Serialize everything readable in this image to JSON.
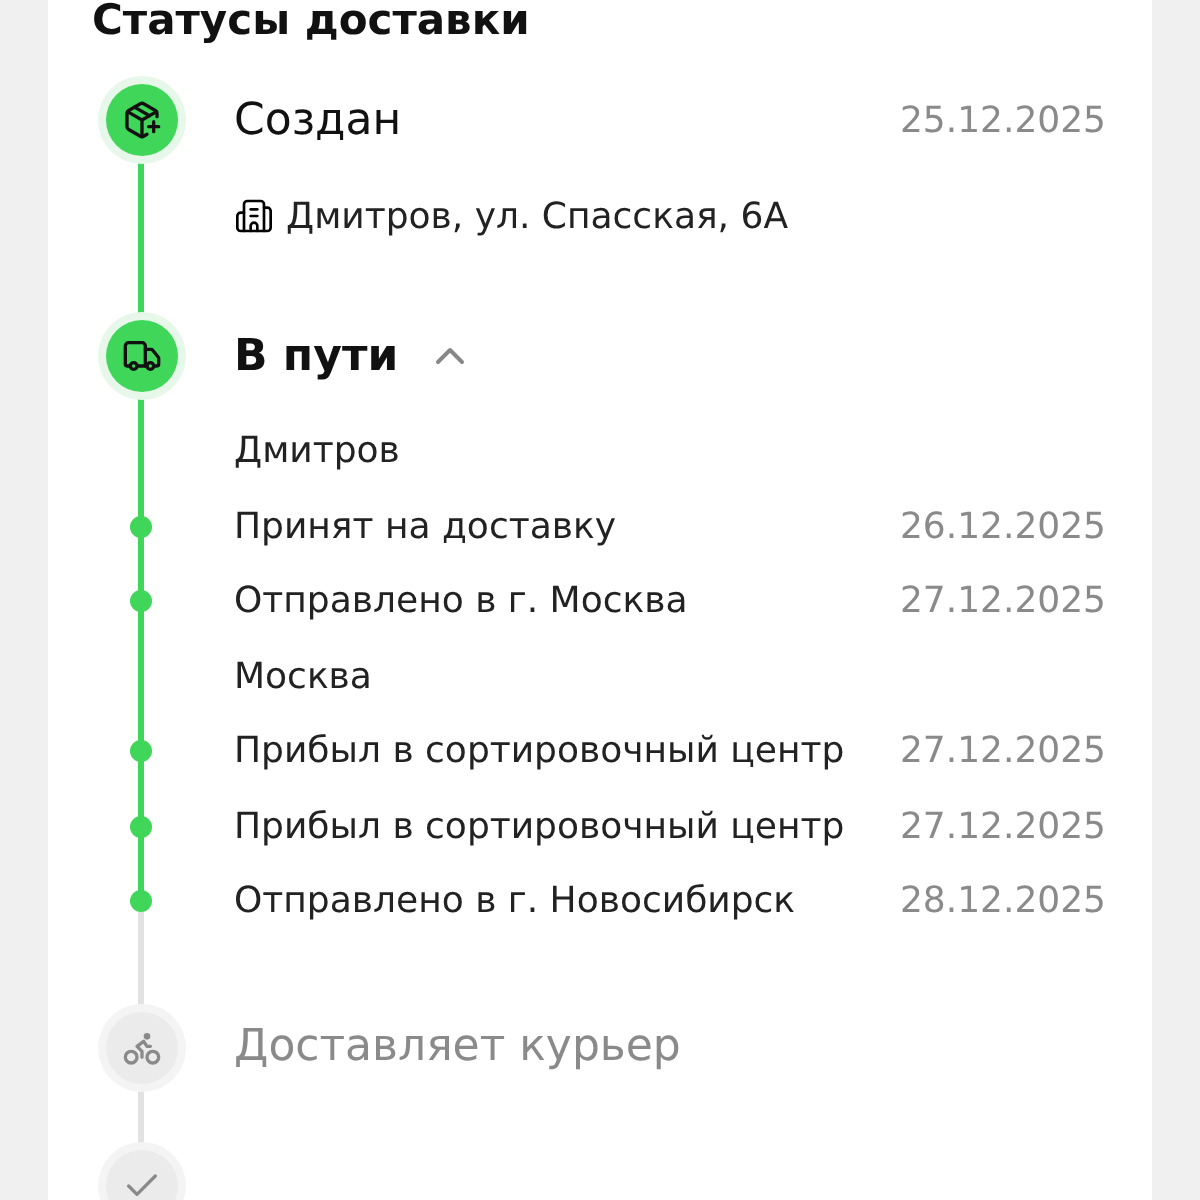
{
  "title": "Статусы доставки",
  "steps": [
    {
      "kind": "created",
      "title": "Создан",
      "date": "25.12.2025",
      "completed": true,
      "address": "Дмитров, ул. Спасская, 6А"
    },
    {
      "kind": "transit",
      "title": "В пути",
      "completed": true,
      "expanded": true,
      "events": [
        {
          "kind": "city",
          "text": "Дмитров"
        },
        {
          "kind": "event",
          "text": "Принят на доставку",
          "date": "26.12.2025"
        },
        {
          "kind": "event",
          "text": "Отправлено в г. Москва",
          "date": "27.12.2025"
        },
        {
          "kind": "city",
          "text": "Москва"
        },
        {
          "kind": "event",
          "text": "Прибыл в сортировочный центр",
          "date": "27.12.2025"
        },
        {
          "kind": "event",
          "text": "Прибыл в сортировочный центр",
          "date": "27.12.2025"
        },
        {
          "kind": "event",
          "text": "Отправлено в г. Новосибирск",
          "date": "28.12.2025"
        }
      ]
    },
    {
      "kind": "courier",
      "title": "Доставляет курьер",
      "completed": false
    },
    {
      "kind": "delivered",
      "completed": false
    }
  ]
}
